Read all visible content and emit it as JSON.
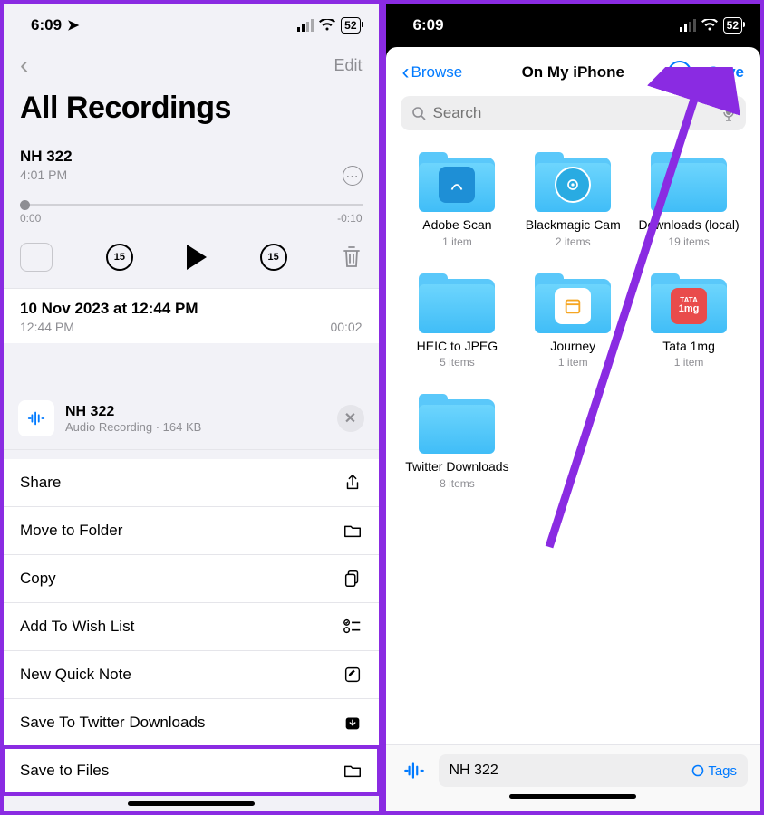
{
  "left": {
    "status": {
      "time": "6:09",
      "battery": "52"
    },
    "nav": {
      "edit": "Edit"
    },
    "title": "All Recordings",
    "current": {
      "name": "NH 322",
      "time": "4:01 PM",
      "start": "0:00",
      "end": "-0:10",
      "skip": "15"
    },
    "rec2": {
      "title": "10 Nov 2023 at 12:44 PM",
      "time": "12:44 PM",
      "dur": "00:02"
    },
    "sheet": {
      "title": "NH 322",
      "subtitle": "Audio Recording · 164 KB",
      "items": {
        "share": "Share",
        "move": "Move to Folder",
        "copy": "Copy",
        "wish": "Add To Wish List",
        "note": "New Quick Note",
        "twitter": "Save To Twitter Downloads",
        "files": "Save to Files"
      }
    }
  },
  "right": {
    "status": {
      "time": "6:09",
      "battery": "52"
    },
    "nav": {
      "back": "Browse",
      "title": "On My iPhone",
      "save": "Save"
    },
    "search": {
      "placeholder": "Search"
    },
    "folders": {
      "adobe": {
        "name": "Adobe Scan",
        "count": "1 item"
      },
      "bmc": {
        "name": "Blackmagic Cam",
        "count": "2 items"
      },
      "dl": {
        "name": "Downloads (local)",
        "count": "19 items"
      },
      "heic": {
        "name": "HEIC to JPEG",
        "count": "5 items"
      },
      "journey": {
        "name": "Journey",
        "count": "1 item"
      },
      "tata": {
        "name": "Tata 1mg",
        "count": "1 item"
      },
      "twitter": {
        "name": "Twitter Downloads",
        "count": "8 items"
      }
    },
    "footer": {
      "filename": "NH 322",
      "tags": "Tags"
    }
  }
}
